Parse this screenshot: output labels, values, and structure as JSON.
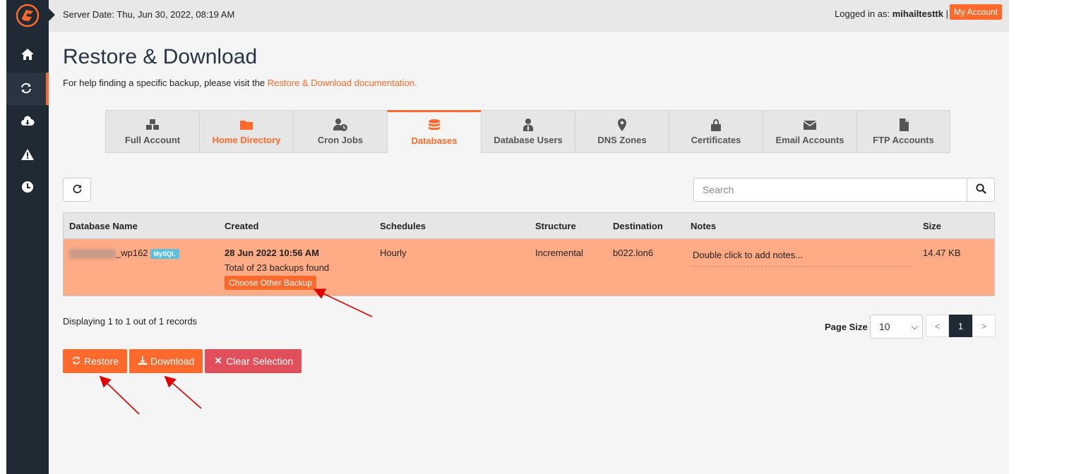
{
  "header": {
    "server_date": "Server Date: Thu, Jun 30, 2022, 08:19 AM",
    "logged_in_prefix": "Logged in as: ",
    "username": "mihailtesttk",
    "separator": "|",
    "my_account_label": "My Account"
  },
  "sidebar": {
    "items": [
      {
        "icon": "home-icon"
      },
      {
        "icon": "sync-icon",
        "active": true
      },
      {
        "icon": "cloud-download-icon"
      },
      {
        "icon": "warning-icon"
      },
      {
        "icon": "clock-icon"
      }
    ]
  },
  "page": {
    "title": "Restore & Download",
    "help_text": "For help finding a specific backup, please visit the ",
    "help_link": "Restore & Download documentation."
  },
  "tabs": [
    {
      "label": "Full Account",
      "icon": "cubes-icon"
    },
    {
      "label": "Home Directory",
      "icon": "folder-icon"
    },
    {
      "label": "Cron Jobs",
      "icon": "user-clock-icon"
    },
    {
      "label": "Databases",
      "icon": "database-icon",
      "active": true
    },
    {
      "label": "Database Users",
      "icon": "user-tie-icon"
    },
    {
      "label": "DNS Zones",
      "icon": "map-marker-icon"
    },
    {
      "label": "Certificates",
      "icon": "lock-icon"
    },
    {
      "label": "Email Accounts",
      "icon": "envelope-icon"
    },
    {
      "label": "FTP Accounts",
      "icon": "file-icon"
    }
  ],
  "search": {
    "placeholder": "Search"
  },
  "table": {
    "headers": [
      "Database Name",
      "Created",
      "Schedules",
      "Structure",
      "Destination",
      "Notes",
      "Size"
    ],
    "rows": [
      {
        "name_suffix": "_wp162",
        "badge": "MySQL",
        "created_date": "28 Jun 2022 10:56 AM",
        "created_total": "Total of 23 backups found",
        "choose_label": "Choose Other Backup",
        "schedule": "Hourly",
        "structure": "Incremental",
        "destination": "b022.lon6",
        "notes": "Double click to add notes...",
        "size": "14.47 KB"
      }
    ]
  },
  "footer": {
    "displaying": "Displaying 1 to 1 out of 1 records",
    "page_size_label": "Page Size",
    "page_size_value": "10",
    "pager": {
      "prev": "<",
      "current": "1",
      "next": ">"
    }
  },
  "actions": {
    "restore": "Restore",
    "download": "Download",
    "clear": "Clear Selection"
  },
  "colors": {
    "accent": "#ff6a2c",
    "sidebar": "#1f2a35",
    "row_selected": "#ffab85",
    "danger": "#e1505a",
    "badge": "#5bc0de"
  }
}
